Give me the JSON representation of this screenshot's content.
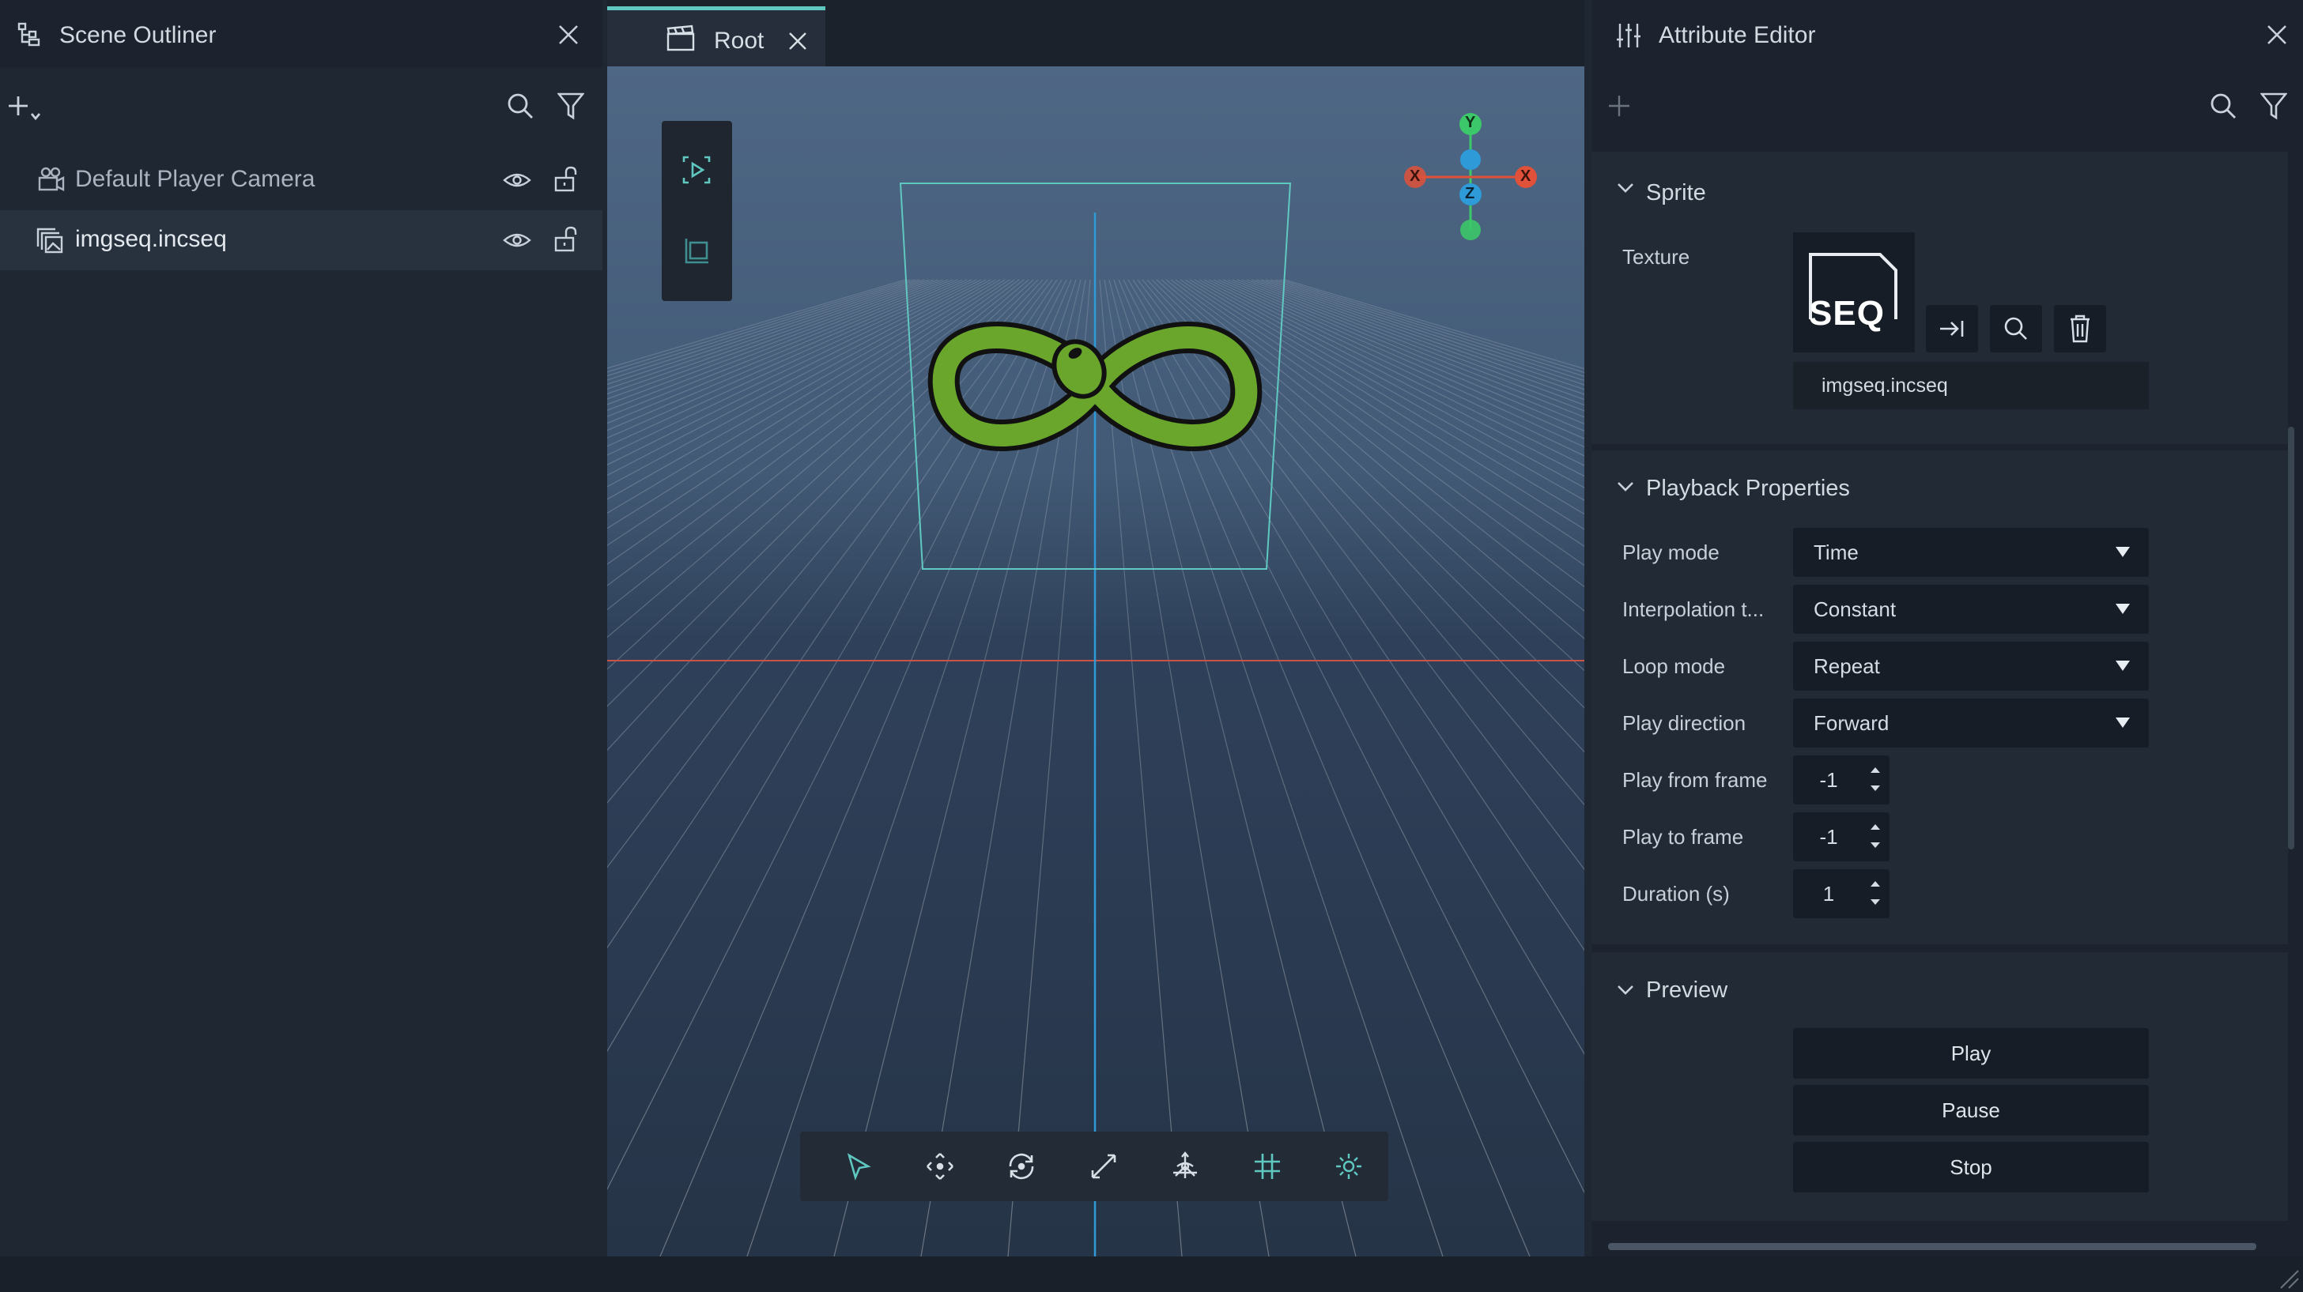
{
  "outliner": {
    "title": "Scene Outliner",
    "items": [
      {
        "label": "Default Player Camera",
        "icon": "camera-icon",
        "visible": true,
        "locked": false
      },
      {
        "label": "imgseq.incseq",
        "icon": "image-sequence-icon",
        "visible": true,
        "locked": false,
        "selected": true
      }
    ]
  },
  "viewport": {
    "tab_label": "Root",
    "gizmo_axes": {
      "x": "X",
      "y": "Y",
      "z": "Z"
    },
    "left_tools": [
      "play-camera-icon",
      "frame-icon"
    ],
    "bottom_tools": [
      "select-tool-icon",
      "move-tool-icon",
      "rotate-tool-icon",
      "scale-tool-icon",
      "transform-tool-icon",
      "grid-snap-icon",
      "lighting-icon"
    ]
  },
  "attributes": {
    "title": "Attribute Editor",
    "sprite": {
      "section_title": "Sprite",
      "texture_label": "Texture",
      "texture_thumb_text": "SEQ",
      "texture_file": "imgseq.incseq"
    },
    "playback": {
      "section_title": "Playback Properties",
      "play_mode_label": "Play mode",
      "play_mode_value": "Time",
      "interp_label": "Interpolation t...",
      "interp_value": "Constant",
      "loop_label": "Loop mode",
      "loop_value": "Repeat",
      "direction_label": "Play direction",
      "direction_value": "Forward",
      "from_label": "Play from frame",
      "from_value": "-1",
      "to_label": "Play to frame",
      "to_value": "-1",
      "duration_label": "Duration (s)",
      "duration_value": "1"
    },
    "preview": {
      "section_title": "Preview",
      "play": "Play",
      "pause": "Pause",
      "stop": "Stop"
    }
  },
  "colors": {
    "accent": "#5fc8c0",
    "axis_x": "#e0513a",
    "axis_y": "#3cc86a",
    "axis_z": "#2f9ad8",
    "logo_green": "#6aa52c"
  }
}
